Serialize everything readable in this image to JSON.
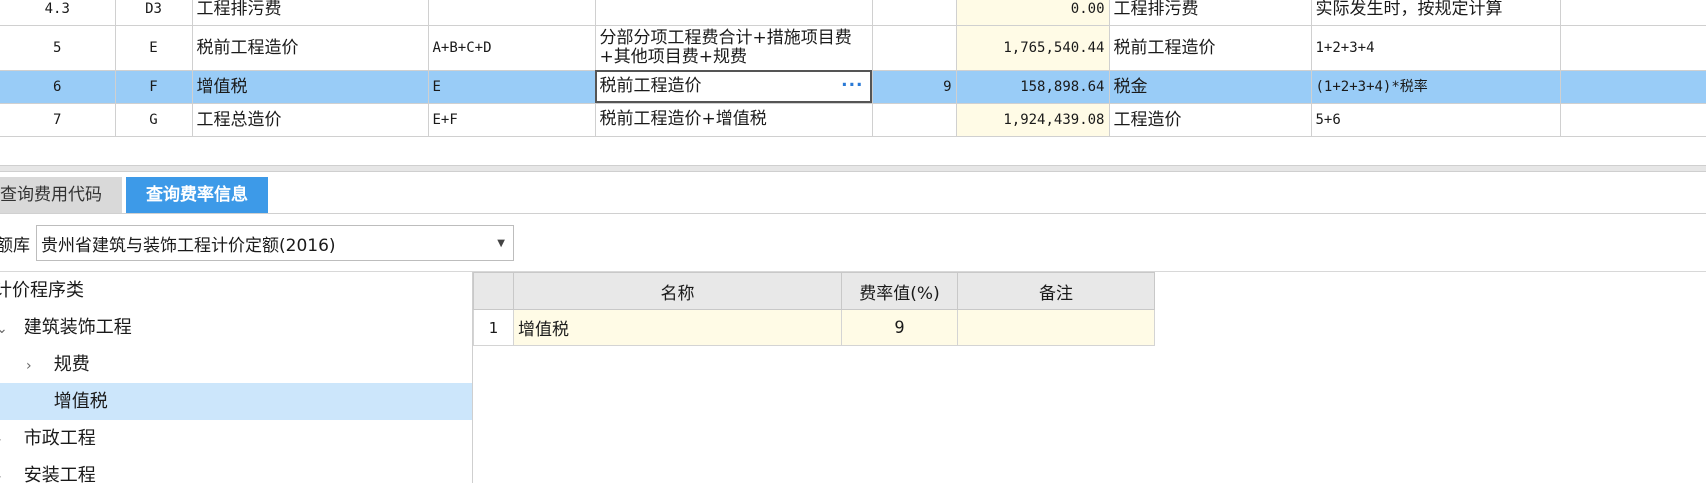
{
  "fee_table": {
    "rows": [
      {
        "seq": "4.3",
        "code": "D3",
        "name": "工程排污费",
        "formula": "",
        "base": "",
        "rate": "",
        "amount": "0.00",
        "fee_type": "工程排污费",
        "note": "实际发生时，按规定计算",
        "selected": false
      },
      {
        "seq": "5",
        "code": "E",
        "name": "税前工程造价",
        "formula": "A+B+C+D",
        "base": "分部分项工程费合计+措施项目费+其他项目费+规费",
        "rate": "",
        "amount": "1,765,540.44",
        "fee_type": "税前工程造价",
        "note": "1+2+3+4",
        "selected": false
      },
      {
        "seq": "6",
        "code": "F",
        "name": "增值税",
        "formula": "E",
        "base": "税前工程造价",
        "rate": "9",
        "amount": "158,898.64",
        "fee_type": "税金",
        "note": "(1+2+3+4)*税率",
        "selected": true
      },
      {
        "seq": "7",
        "code": "G",
        "name": "工程总造价",
        "formula": "E+F",
        "base": "税前工程造价+增值税",
        "rate": "",
        "amount": "1,924,439.08",
        "fee_type": "工程造价",
        "note": "5+6",
        "selected": false
      }
    ],
    "ellipsis": "···"
  },
  "tabs": [
    {
      "label": "查询费用代码",
      "active": false
    },
    {
      "label": "查询费率信息",
      "active": true
    }
  ],
  "library": {
    "label": "额库",
    "selected": "贵州省建筑与装饰工程计价定额(2016)"
  },
  "tree": {
    "root": "计价程序类",
    "nodes": [
      {
        "label": "建筑装饰工程",
        "arrow": "⌄",
        "level": 1,
        "selected": false
      },
      {
        "label": "规费",
        "arrow": "›",
        "level": 2,
        "selected": false
      },
      {
        "label": "增值税",
        "arrow": "",
        "level": 2,
        "selected": true
      },
      {
        "label": "市政工程",
        "arrow": "›",
        "level": 1,
        "selected": false
      },
      {
        "label": "安装工程",
        "arrow": "›",
        "level": 1,
        "selected": false
      }
    ]
  },
  "rate_table": {
    "headers": [
      "",
      "名称",
      "费率值(%)",
      "备注"
    ],
    "rows": [
      {
        "num": "1",
        "name": "增值税",
        "value": "9",
        "note": ""
      }
    ]
  },
  "colors": {
    "selected_row": "#99ccf7",
    "amount_cell": "#fffbe6",
    "active_tab": "#3d9ae8",
    "tree_selected": "#cce6fb"
  }
}
